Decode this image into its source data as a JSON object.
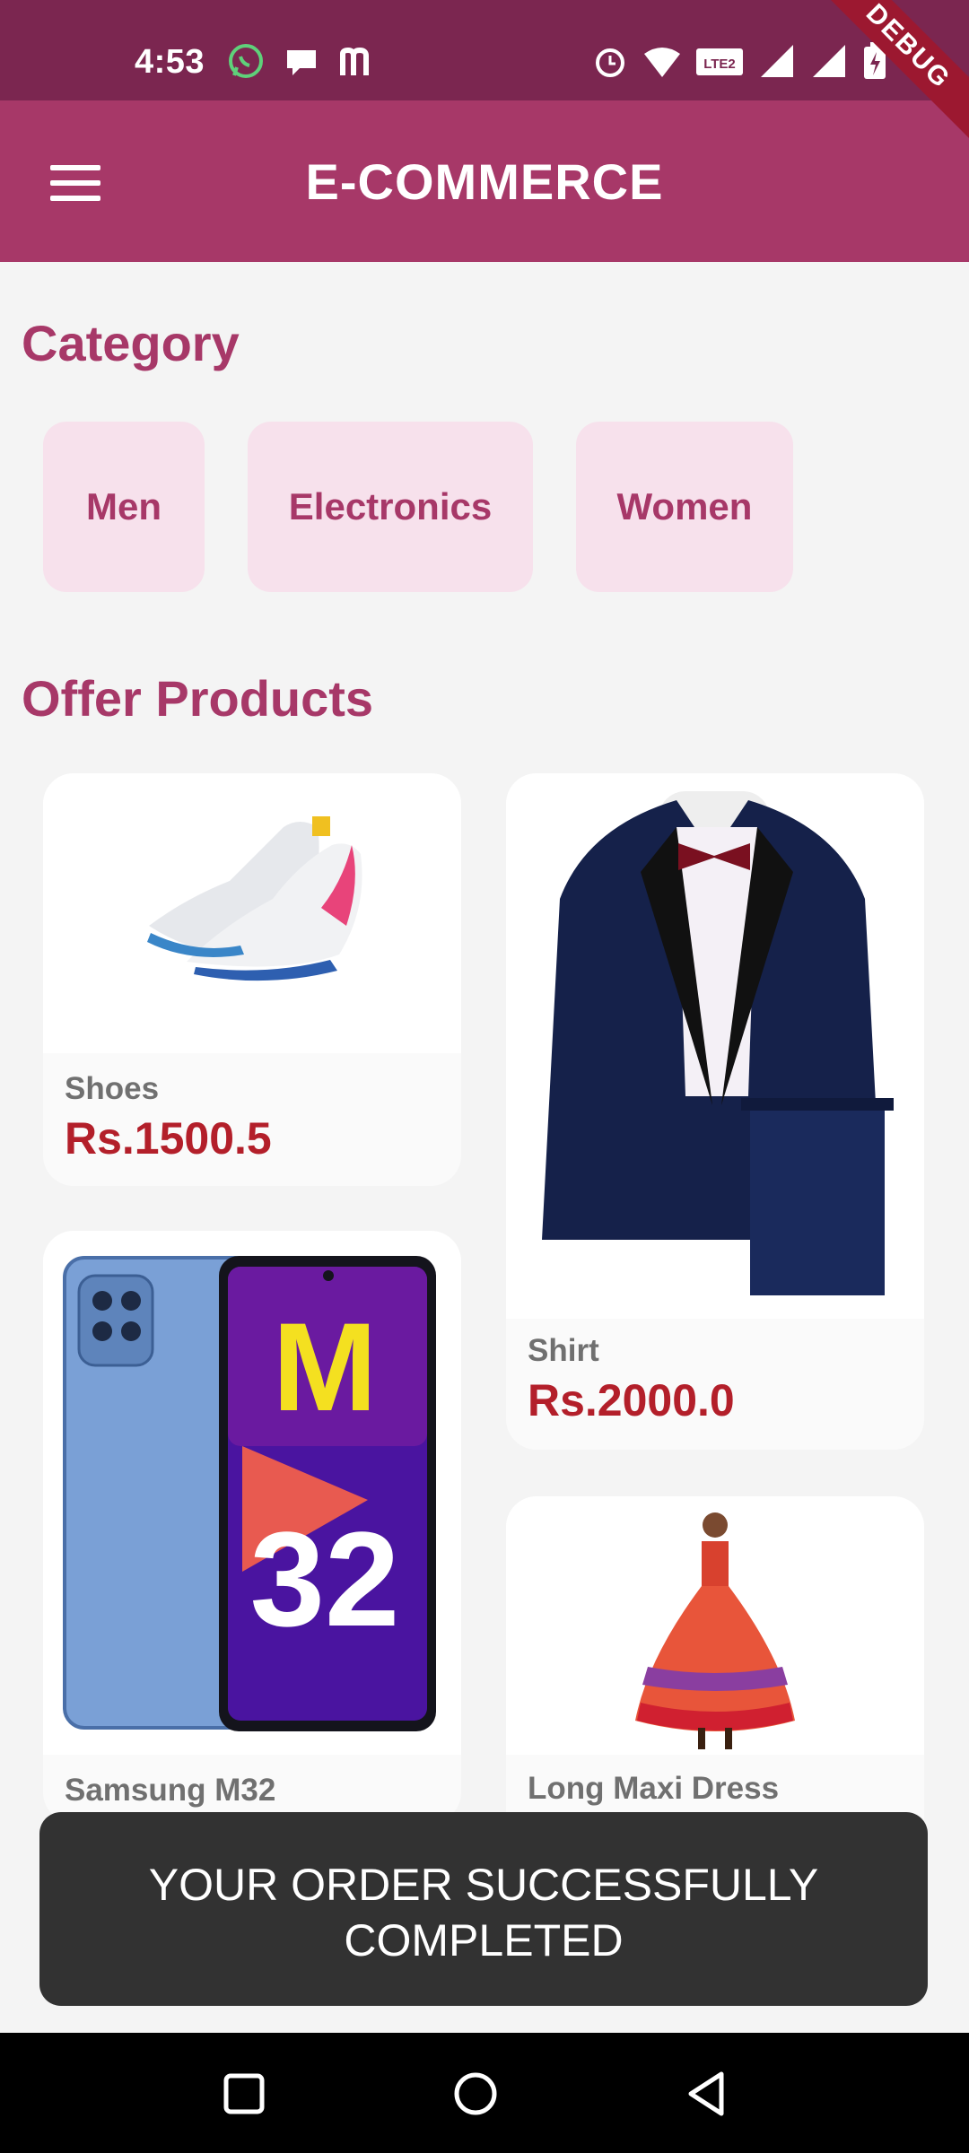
{
  "status_bar": {
    "time": "4:53",
    "left_icons": [
      "whatsapp-icon",
      "chat-bubble-icon",
      "m-logo-icon"
    ],
    "right_icons": [
      "alarm-icon",
      "wifi-icon",
      "volte-icon",
      "signal-icon",
      "signal-icon",
      "battery-icon"
    ],
    "debug_label": "DEBUG"
  },
  "app_bar": {
    "title": "E-COMMERCE",
    "menu_icon": "hamburger-menu-icon"
  },
  "category": {
    "title": "Category",
    "items": [
      "Men",
      "Electronics",
      "Women"
    ]
  },
  "offers": {
    "title": "Offer Products",
    "products": [
      {
        "name": "Shoes",
        "price": "Rs.1500.5"
      },
      {
        "name": "Shirt",
        "price": "Rs.2000.0"
      },
      {
        "name": "Samsung M32",
        "price": ""
      },
      {
        "name": "Long Maxi Dress",
        "price": ""
      }
    ]
  },
  "toast": {
    "message_line1": "YOUR ORDER SUCCESSFULLY",
    "message_line2": "COMPLETED"
  },
  "nav_bar": {
    "buttons": [
      "recent-apps-icon",
      "home-icon",
      "back-icon"
    ]
  },
  "colors": {
    "primary": "#a73868",
    "status_bar": "#7b2650",
    "chip_bg": "#f7e1ec",
    "price": "#b31f2a",
    "toast_bg": "#323232"
  }
}
